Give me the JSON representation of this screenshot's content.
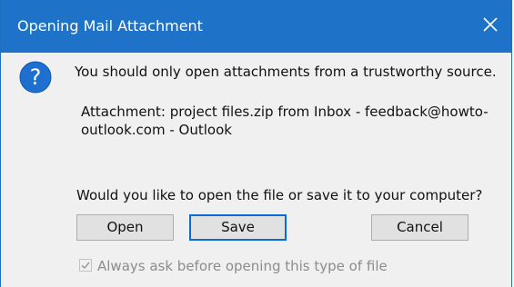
{
  "window": {
    "title": "Opening Mail Attachment",
    "close_icon": "close-icon",
    "titlebar_color": "#1e73c8"
  },
  "content": {
    "icon": "question-icon",
    "warning": "You should only open attachments from a trustworthy source.",
    "attachment": "Attachment: project files.zip from Inbox - feedback@howto-outlook.com - Outlook",
    "question": "Would you like to open the file or save it to your computer?"
  },
  "buttons": {
    "open": "Open",
    "save": "Save",
    "cancel": "Cancel"
  },
  "checkbox": {
    "label": "Always ask before opening this type of file",
    "checked": true,
    "enabled": false
  }
}
